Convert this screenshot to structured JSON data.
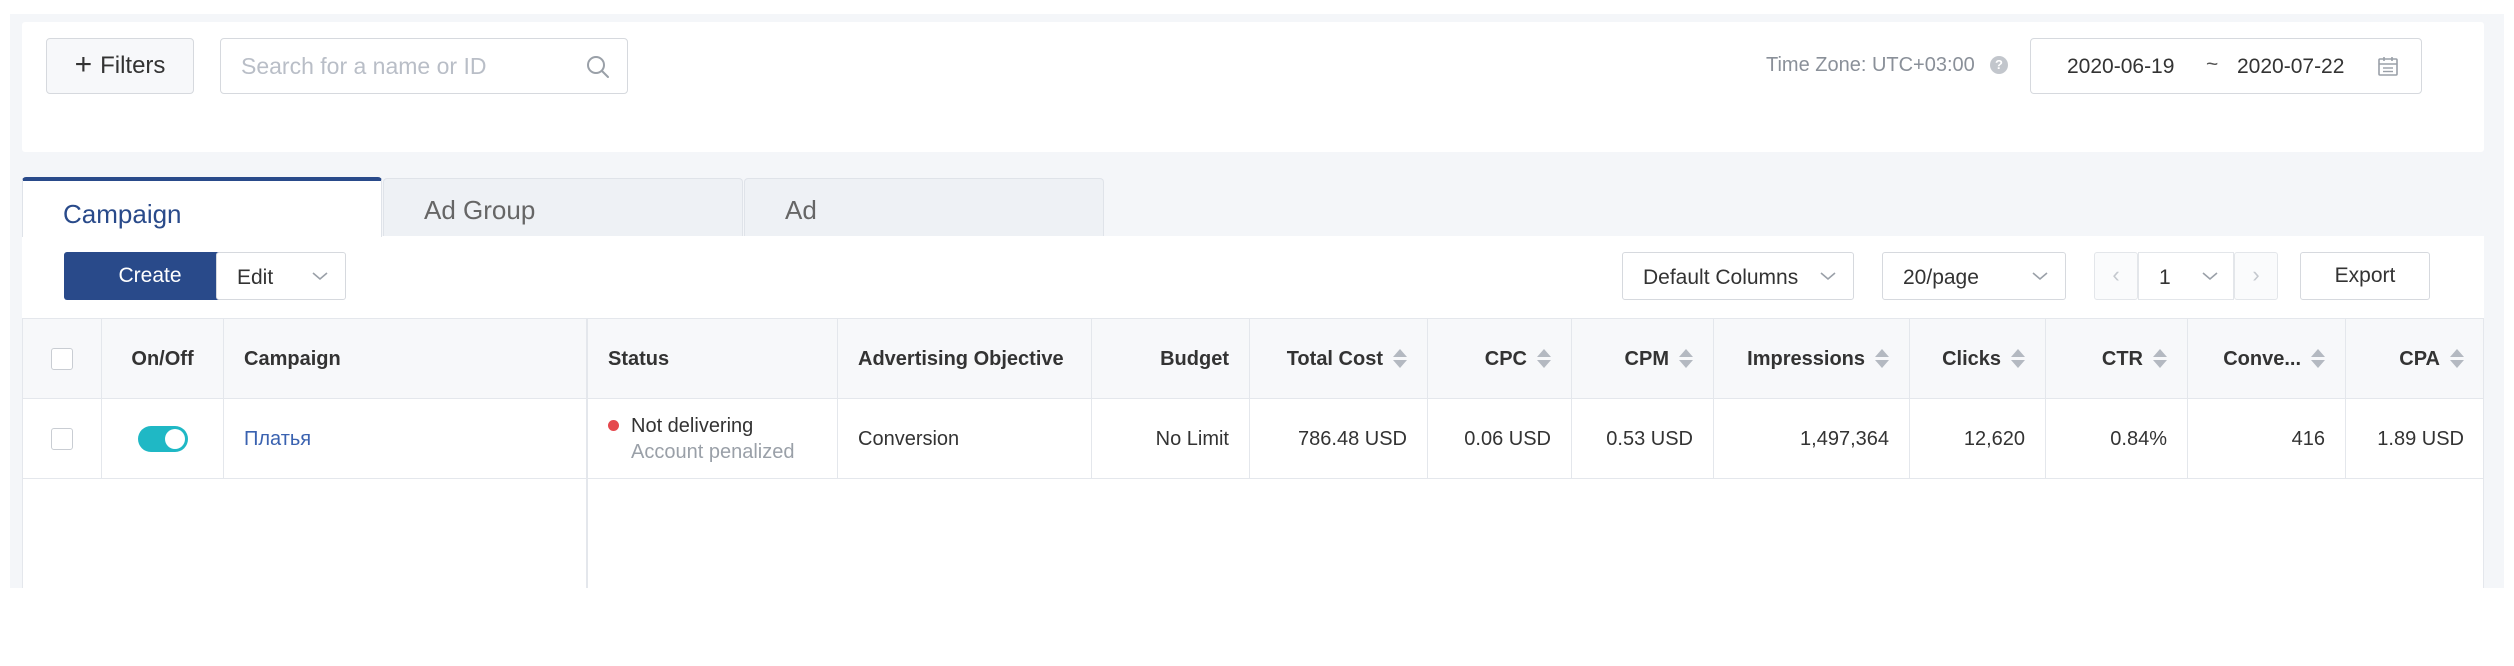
{
  "toolbar_top": {
    "filters_label": "Filters",
    "search_placeholder": "Search for a name or ID",
    "timezone_label": "Time Zone: UTC+03:00",
    "date_start": "2020-06-19",
    "date_separator": "~",
    "date_end": "2020-07-22"
  },
  "tabs": [
    {
      "label": "Campaign",
      "active": true
    },
    {
      "label": "Ad Group",
      "active": false
    },
    {
      "label": "Ad",
      "active": false
    }
  ],
  "actions": {
    "create_label": "Create",
    "edit_label": "Edit",
    "columns_label": "Default Columns",
    "page_size_label": "20/page",
    "current_page": "1",
    "export_label": "Export"
  },
  "table": {
    "headers": {
      "onoff": "On/Off",
      "campaign": "Campaign",
      "status": "Status",
      "objective": "Advertising Objective",
      "budget": "Budget",
      "total_cost": "Total Cost",
      "cpc": "CPC",
      "cpm": "CPM",
      "impressions": "Impressions",
      "clicks": "Clicks",
      "ctr": "CTR",
      "conversions": "Conve...",
      "cpa": "CPA"
    },
    "rows": [
      {
        "enabled": true,
        "campaign": "Платья",
        "status": "Not delivering",
        "status_reason": "Account penalized",
        "objective": "Conversion",
        "budget": "No Limit",
        "total_cost": "786.48 USD",
        "cpc": "0.06 USD",
        "cpm": "0.53 USD",
        "impressions": "1,497,364",
        "clicks": "12,620",
        "ctr": "0.84%",
        "conversions": "416",
        "cpa": "1.89 USD"
      }
    ]
  },
  "colors": {
    "primary": "#294a8a",
    "toggle_on": "#1fb8c5",
    "status_error": "#e5484d",
    "link": "#3a62b0"
  }
}
